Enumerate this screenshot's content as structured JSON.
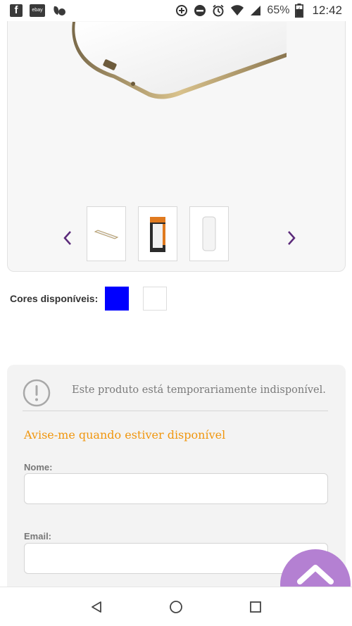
{
  "status_bar": {
    "left_icons": [
      "facebook-icon",
      "ebay-icon",
      "cloud-icon"
    ],
    "fb_letter": "f",
    "ebay_text": "ebay",
    "right_icons": [
      "data-saver-icon",
      "do-not-disturb-icon",
      "alarm-icon",
      "wifi-icon",
      "signal-icon",
      "battery-charging-icon"
    ],
    "battery_percent": "65%",
    "time": "12:42"
  },
  "product": {
    "thumbnails": [
      "thumbnail-powerbank-flat",
      "thumbnail-powerbank-box",
      "thumbnail-powerbank-front"
    ],
    "prev_icon": "chevron-left-icon",
    "next_icon": "chevron-right-icon",
    "arrow_color": "#5b2a7a"
  },
  "colors": {
    "label": "Cores disponíveis:",
    "swatches": [
      {
        "name": "blue",
        "hex": "#0000ff"
      },
      {
        "name": "white",
        "hex": "#ffffff"
      }
    ]
  },
  "notice": {
    "icon": "alert-circle-icon",
    "message": "Este produto está temporariamente indisponível.",
    "notify_title": "Avise-me quando estiver disponível",
    "notify_title_color": "#f0960e",
    "name_label": "Nome:",
    "name_value": "",
    "email_label": "Email:",
    "email_value": ""
  },
  "fab": {
    "icon": "chevron-up-icon",
    "color": "#b480d2"
  },
  "nav_bar": {
    "icons": [
      "back-icon",
      "home-icon",
      "recents-icon"
    ]
  }
}
